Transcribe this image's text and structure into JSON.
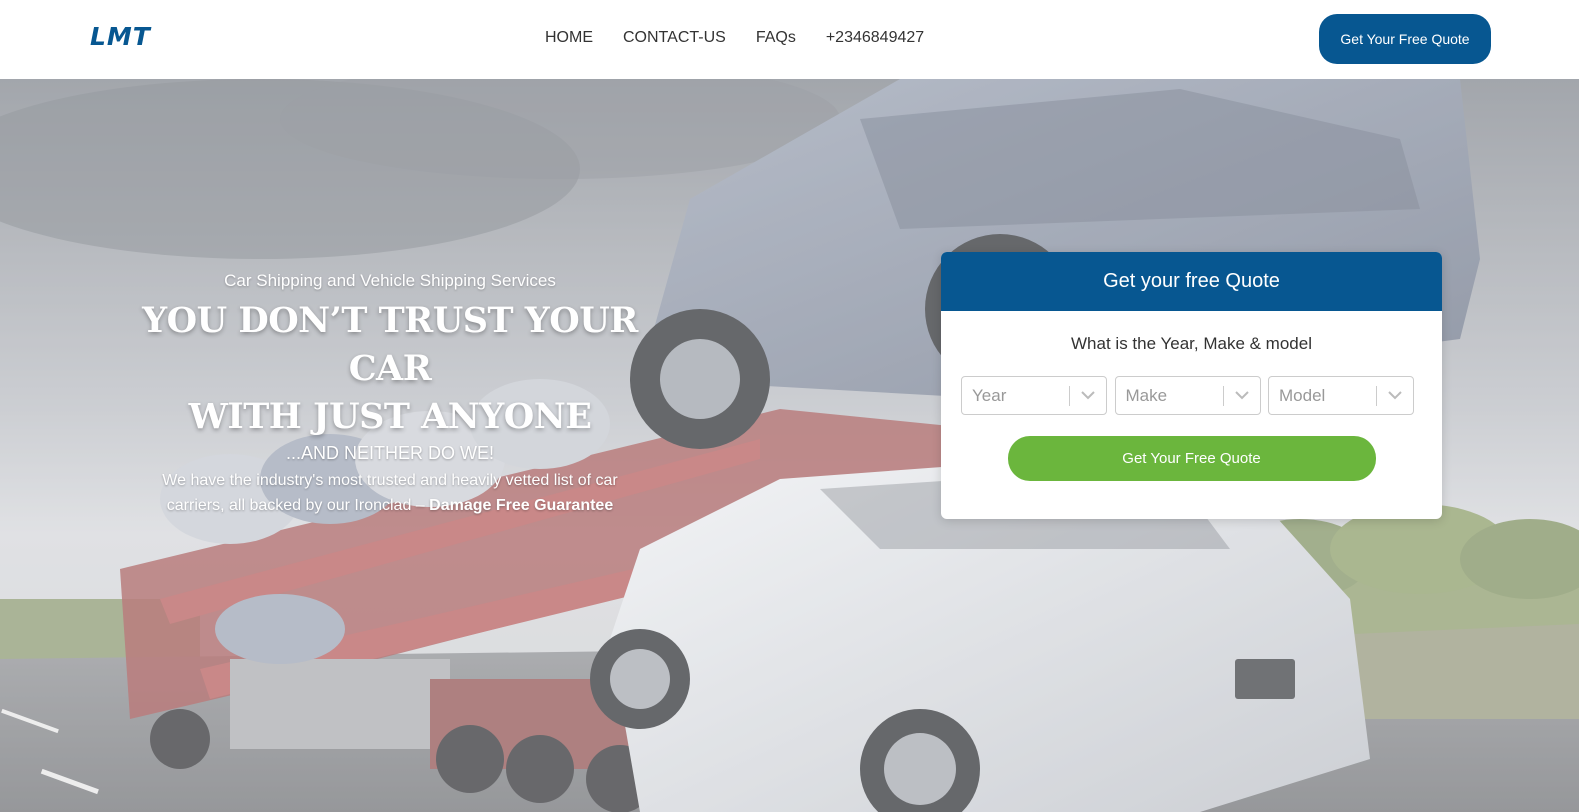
{
  "brand": {
    "logo_text": "LMT"
  },
  "nav": {
    "links": [
      "HOME",
      "CONTACT-US",
      "FAQs",
      "+2346849427"
    ],
    "cta_label": "Get Your Free Quote"
  },
  "hero": {
    "subtitle": "Car Shipping and Vehicle Shipping Services",
    "headline_line1": "YOU DON’T TRUST YOUR CAR",
    "headline_line2": "WITH JUST ANYONE",
    "tagline": "...AND NEITHER DO WE!",
    "description": "We have the industry's most trusted and heavily vetted list of car carriers, all backed by our Ironclad –",
    "description_bold": "Damage Free Guarantee",
    "background_image": "car-carrier-truck-photo"
  },
  "quote_form": {
    "title": "Get your free Quote",
    "question": "What is the Year, Make & model",
    "selects": [
      {
        "placeholder": "Year"
      },
      {
        "placeholder": "Make"
      },
      {
        "placeholder": "Model"
      }
    ],
    "submit_label": "Get Your Free Quote"
  },
  "colors": {
    "brand_blue": "#075791",
    "cta_green": "#6bb63d",
    "nav_text": "#333333",
    "placeholder_gray": "#999999"
  }
}
